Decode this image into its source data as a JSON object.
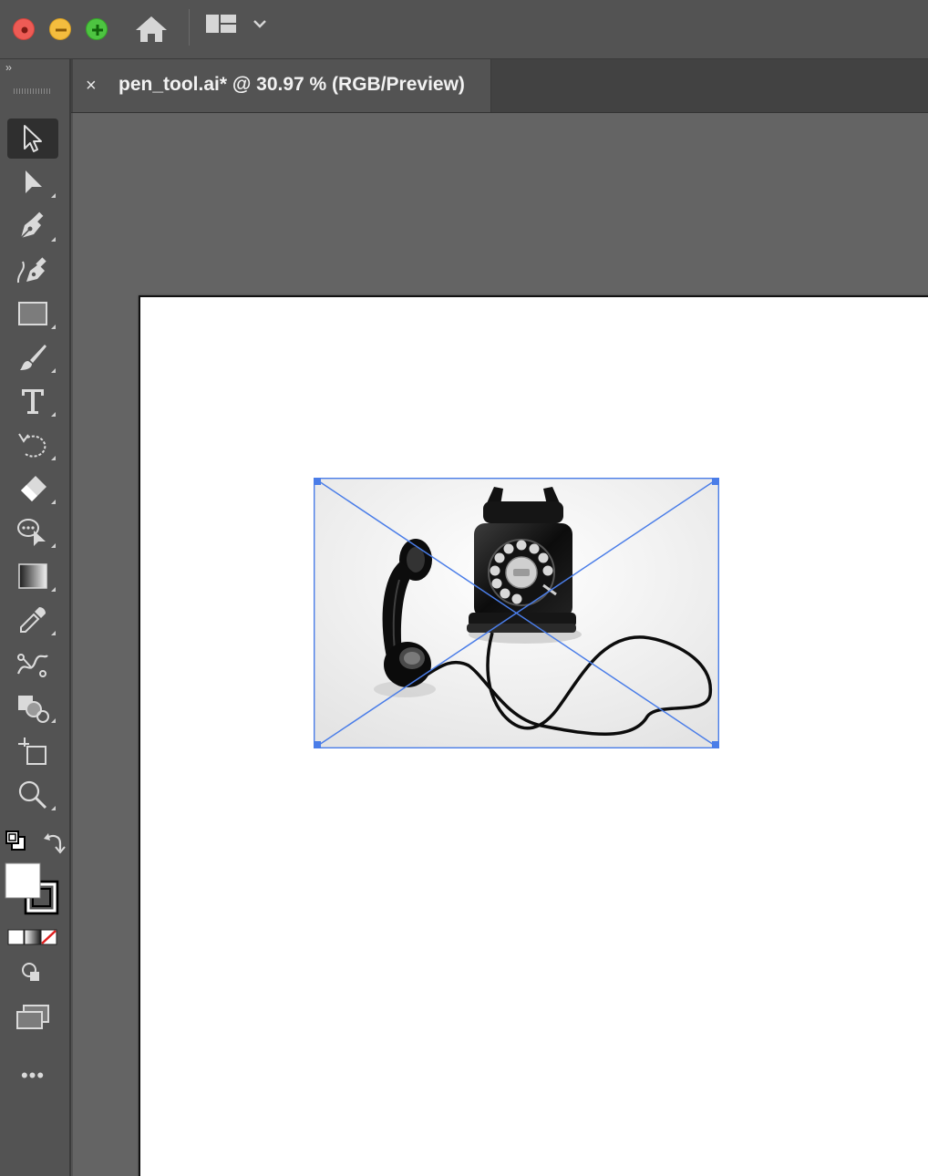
{
  "window": {
    "controls": [
      "close",
      "minimize",
      "zoom"
    ],
    "icons": {
      "home": "home-icon",
      "workspace": "workspace-switcher-icon",
      "workspace_menu": "chevron-down-icon"
    }
  },
  "document_tab": {
    "title": "pen_tool.ai* @ 30.97 % (RGB/Preview)",
    "close_label": "×"
  },
  "toolbar": {
    "collapse_label": "››",
    "tools": [
      {
        "name": "selection-tool",
        "icon": "selection-arrow-icon",
        "active": true
      },
      {
        "name": "direct-selection-tool",
        "icon": "direct-selection-icon",
        "active": false
      },
      {
        "name": "pen-tool",
        "icon": "pen-icon",
        "active": false
      },
      {
        "name": "curvature-tool",
        "icon": "curvature-icon",
        "active": false
      },
      {
        "name": "rectangle-tool",
        "icon": "rectangle-icon",
        "active": false
      },
      {
        "name": "paintbrush-tool",
        "icon": "paintbrush-icon",
        "active": false
      },
      {
        "name": "type-tool",
        "icon": "type-icon",
        "active": false
      },
      {
        "name": "rotate-tool",
        "icon": "rotate-icon",
        "active": false
      },
      {
        "name": "eraser-tool",
        "icon": "eraser-icon",
        "active": false
      },
      {
        "name": "puppet-warp-tool",
        "icon": "puppet-warp-icon",
        "active": false
      },
      {
        "name": "gradient-tool",
        "icon": "gradient-icon",
        "active": false
      },
      {
        "name": "eyedropper-tool",
        "icon": "eyedropper-icon",
        "active": false
      },
      {
        "name": "blend-tool",
        "icon": "blend-icon",
        "active": false
      },
      {
        "name": "shape-builder-tool",
        "icon": "shape-builder-icon",
        "active": false
      },
      {
        "name": "artboard-tool",
        "icon": "artboard-icon",
        "active": false
      },
      {
        "name": "zoom-tool",
        "icon": "zoom-icon",
        "active": false
      }
    ],
    "more_label": "•••"
  },
  "colors": {
    "ui_background": "#535353",
    "canvas_background": "#646464",
    "artboard": "#ffffff",
    "selection": "#4a7de8",
    "fill": "#ffffff",
    "stroke": "#000000"
  },
  "placed_image": {
    "subject": "vintage rotary telephone",
    "selected": true
  }
}
